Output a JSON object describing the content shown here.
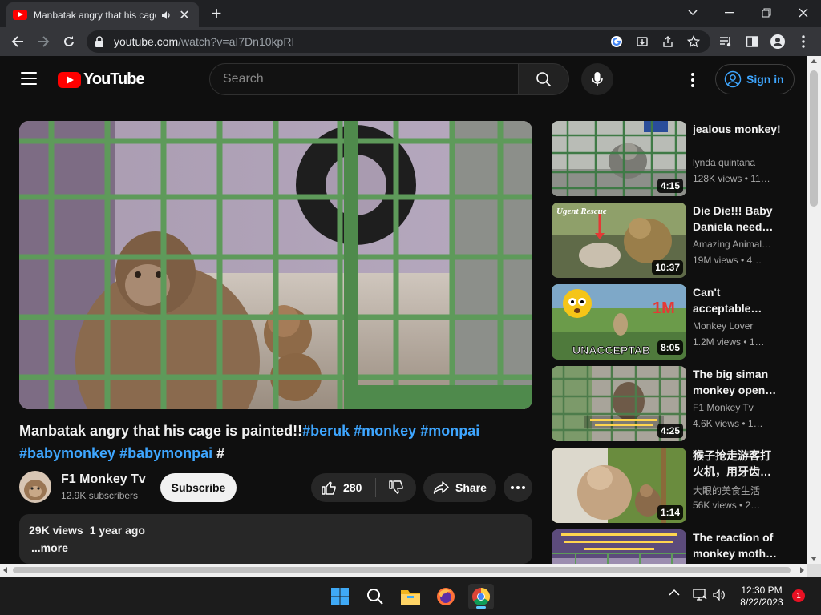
{
  "browser": {
    "tab_title": "Manbatak angry that his cage is painted!!",
    "url_host": "youtube.com",
    "url_path": "/watch?v=aI7Dn10kpRI"
  },
  "youtube": {
    "logo_text": "YouTube",
    "search_placeholder": "Search",
    "sign_in": "Sign in"
  },
  "video": {
    "title_plain": "Manbatak angry that his cage is painted!!",
    "tags": [
      "#beruk",
      "#monkey",
      "#monpai",
      "#babymonkey",
      "#babymonpai",
      "#"
    ],
    "channel_name": "F1 Monkey Tv",
    "subscribers": "12.9K subscribers",
    "subscribe_label": "Subscribe",
    "likes": "280",
    "share_label": "Share",
    "views": "29K views",
    "age": "1 year ago",
    "more_label": "...more"
  },
  "recommendations": [
    {
      "title": "jealous monkey!",
      "channel": "lynda quintana",
      "meta": "128K views  •  11…",
      "duration": "4:15",
      "theme": "cage"
    },
    {
      "title": "Die Die!!! Baby Daniela need…",
      "channel": "Amazing Animal…",
      "meta": "19M views  •  4…",
      "duration": "10:37",
      "theme": "rescue"
    },
    {
      "title": "Can't acceptable…",
      "channel": "Monkey Lover",
      "meta": "1.2M views  •  1…",
      "duration": "8:05",
      "theme": "unacceptable"
    },
    {
      "title": "The big siman monkey open…",
      "channel": "F1 Monkey Tv",
      "meta": "4.6K views  •  1…",
      "duration": "4:25",
      "theme": "cage2"
    },
    {
      "title": "猴子抢走游客打火机，用牙齿…",
      "channel": "大眼的美食生活",
      "meta": "56K views  •  2…",
      "duration": "1:14",
      "theme": "forest"
    },
    {
      "title": "The reaction of monkey moth…",
      "channel": "",
      "meta": "",
      "duration": "",
      "theme": "purple"
    }
  ],
  "thumb_texts": {
    "rescue_banner": "Ugent Rescue",
    "unacceptable_banner": "UNACCEPTAB",
    "million_badge": "1M"
  },
  "taskbar": {
    "time": "12:30 PM",
    "date": "8/22/2023",
    "notifications": "1"
  },
  "colors": {
    "youtube_red": "#ff0000",
    "link_blue": "#3ea6ff",
    "cage_green": "#5e9a5a"
  }
}
